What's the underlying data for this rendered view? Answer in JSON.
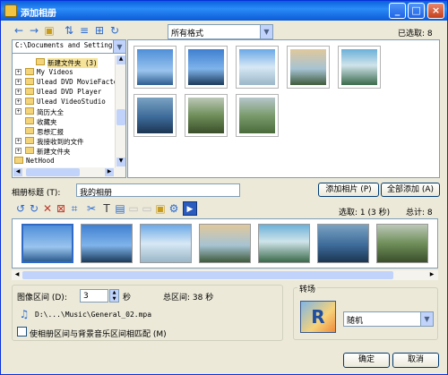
{
  "window": {
    "title": "添加相册",
    "min": "_",
    "max": "□",
    "close": "×"
  },
  "toolbar": {
    "format_value": "所有格式",
    "selected_count": "已选取: 8"
  },
  "tree": {
    "path": "C:\\Documents and Settings\\",
    "items": [
      {
        "label": "新建文件夹 (3)",
        "selected": true
      },
      {
        "label": "My Videos"
      },
      {
        "label": "Ulead DVD MovieFactor"
      },
      {
        "label": "Ulead DVD Player"
      },
      {
        "label": "Ulead VideoStudio"
      },
      {
        "label": "简历大全"
      },
      {
        "label": "收藏夹"
      },
      {
        "label": "思想汇报"
      },
      {
        "label": "我接收到的文件"
      },
      {
        "label": "新建文件夹"
      },
      {
        "label": "NetHood"
      }
    ]
  },
  "album": {
    "title_label": "相册标题 (T):",
    "title_value": "我的相册",
    "add_photo": "添加相片 (P)",
    "add_all": "全部添加 (A)",
    "selection_info": "选取: 1 (3 秒)",
    "total_info": "总计: 8"
  },
  "interval": {
    "label": "图像区间 (D):",
    "value": "3",
    "unit": "秒",
    "total": "总区间: 38 秒",
    "music_path": "D:\\...\\Music\\General_02.mpa",
    "match_label": "使相册区间与背景音乐区间相匹配 (M)"
  },
  "transition": {
    "label": "转场",
    "value": "随机"
  },
  "footer": {
    "ok": "确定",
    "cancel": "取消"
  },
  "colors": {
    "title_bar": "#0a5fdc",
    "selection": "#316ac5",
    "panel_bg": "#ece9d8"
  }
}
